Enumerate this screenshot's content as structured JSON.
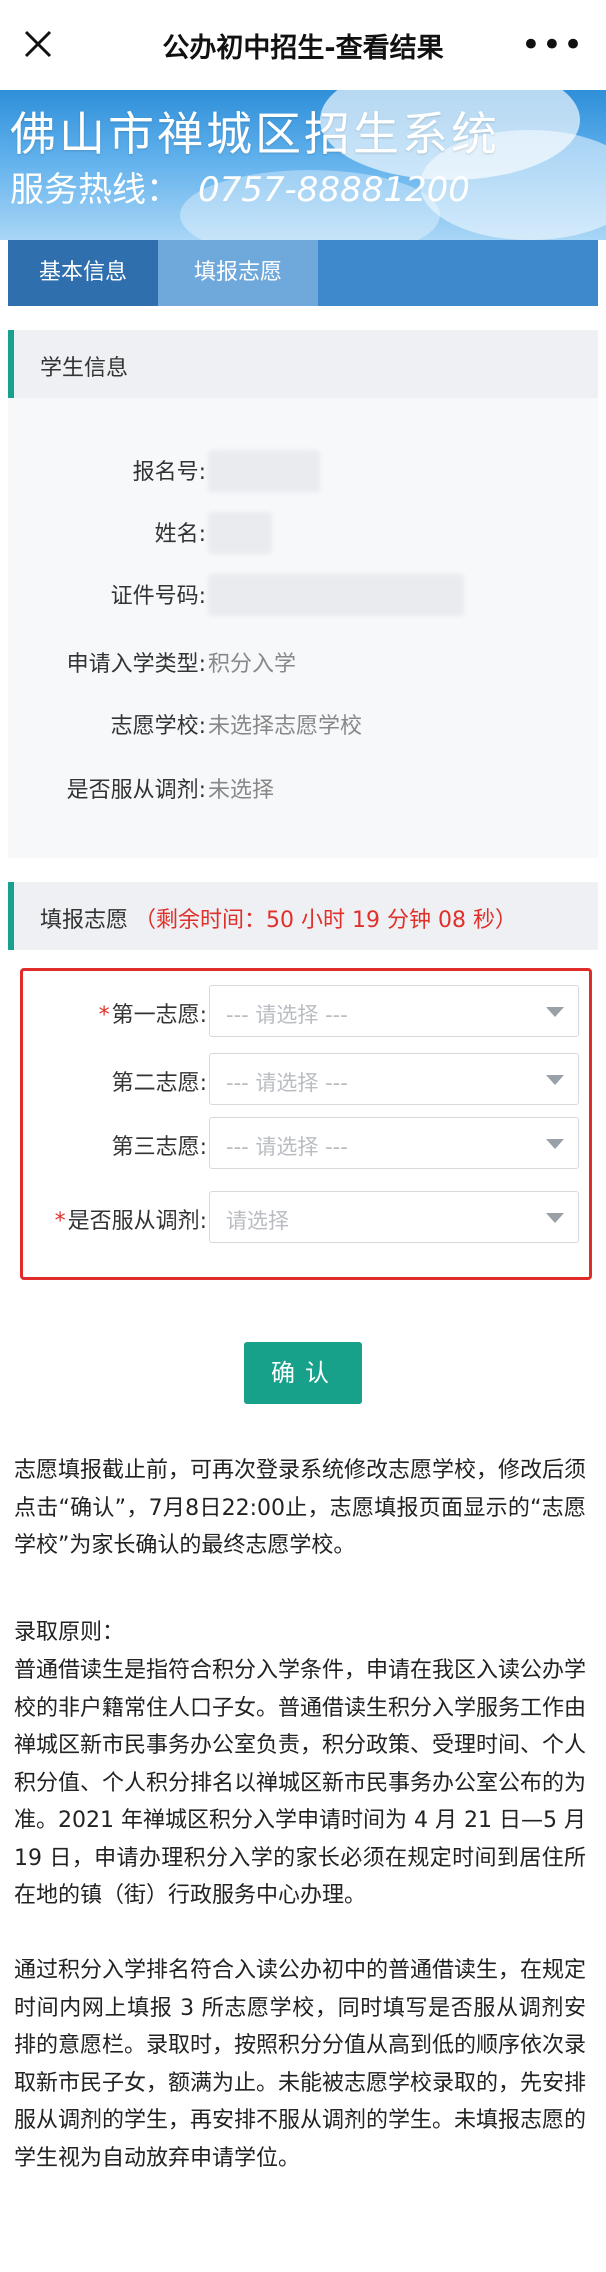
{
  "topbar": {
    "title": "公办初中招生-查看结果"
  },
  "banner": {
    "system_name": "佛山市禅城区招生系统",
    "hotline_label": "服务热线：",
    "hotline_number": "0757-88881200"
  },
  "tabs": [
    "基本信息",
    "填报志愿"
  ],
  "student_info": {
    "heading": "学生信息",
    "fields": [
      {
        "label": "报名号:",
        "value": ""
      },
      {
        "label": "姓名:",
        "value": ""
      },
      {
        "label": "证件号码:",
        "value": ""
      },
      {
        "label": "申请入学类型:",
        "value": "积分入学"
      },
      {
        "label": "志愿学校:",
        "value": "未选择志愿学校"
      },
      {
        "label": "是否服从调剂:",
        "value": "未选择"
      }
    ]
  },
  "wish_form": {
    "heading": "填报志愿",
    "countdown": "（剩余时间：50 小时 19 分钟 08 秒）",
    "rows": [
      {
        "label": "第一志愿:",
        "required": "*",
        "placeholder": "--- 请选择 ---"
      },
      {
        "label": "第二志愿:",
        "required": "",
        "placeholder": "--- 请选择 ---"
      },
      {
        "label": "第三志愿:",
        "required": "",
        "placeholder": "--- 请选择 ---"
      },
      {
        "label": "是否服从调剂:",
        "required": "*",
        "placeholder": "请选择"
      }
    ],
    "confirm_label": "确认"
  },
  "notes": {
    "deadline": "志愿填报截止前，可再次登录系统修改志愿学校，修改后须点击“确认”，7月8日22:00止，志愿填报页面显示的“志愿学校”为家长确认的最终志愿学校。",
    "principle_title": "录取原则：",
    "principle_1": "普通借读生是指符合积分入学条件，申请在我区入读公办学校的非户籍常住人口子女。普通借读生积分入学服务工作由禅城区新市民事务办公室负责，积分政策、受理时间、个人积分值、个人积分排名以禅城区新市民事务办公室公布的为准。2021 年禅城区积分入学申请时间为 4 月 21 日—5 月 19 日，申请办理积分入学的家长必须在规定时间到居住所在地的镇（街）行政服务中心办理。",
    "principle_2": "通过积分入学排名符合入读公办初中的普通借读生，在规定时间内网上填报 3 所志愿学校，同时填写是否服从调剂安排的意愿栏。录取时，按照积分分值从高到低的顺序依次录取新市民子女，额满为止。未能被志愿学校录取的，先安排服从调剂的学生，再安排不服从调剂的学生。未填报志愿的学生视为自动放弃申请学位。"
  }
}
